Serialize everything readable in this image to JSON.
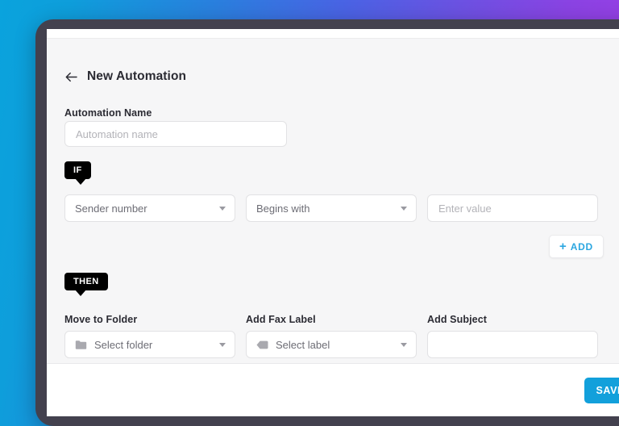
{
  "theme": {
    "gradient_start": "#0aa3dd",
    "gradient_end": "#9f3ce5",
    "device_frame": "#43414e",
    "content_bg": "#f6f6f7",
    "accent_blue": "#12a0db",
    "add_blue": "#2ba6e0",
    "badge_bg": "#000000"
  },
  "header": {
    "back_icon": "arrow-left-icon",
    "title": "New Automation"
  },
  "form": {
    "automation_name": {
      "label": "Automation Name",
      "value": "",
      "placeholder": "Automation name"
    }
  },
  "if_section": {
    "badge": "IF",
    "condition_field": {
      "value": "Sender number",
      "caret_icon": "chevron-down-icon"
    },
    "operator_field": {
      "value": "Begins with",
      "caret_icon": "chevron-down-icon"
    },
    "value_field": {
      "value": "",
      "placeholder": "Enter value"
    },
    "add_button": {
      "plus": "+",
      "label": "ADD",
      "icon": "plus-icon"
    }
  },
  "then_section": {
    "badge": "THEN",
    "move_to_folder": {
      "label": "Move to Folder",
      "value": "Select folder",
      "icon": "folder-icon",
      "caret_icon": "chevron-down-icon"
    },
    "add_fax_label": {
      "label": "Add Fax Label",
      "value": "Select label",
      "icon": "tag-icon",
      "caret_icon": "chevron-down-icon"
    },
    "add_subject": {
      "label": "Add Subject",
      "value": "",
      "placeholder": ""
    }
  },
  "footer": {
    "save_label": "SAVE"
  }
}
